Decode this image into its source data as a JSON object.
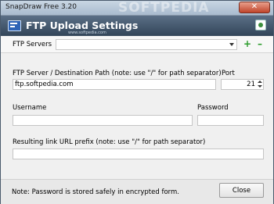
{
  "window": {
    "title": "SnapDraw Free 3.20",
    "watermark": "SOFTPEDIA",
    "close_glyph": "✕"
  },
  "banner": {
    "heading": "FTP Upload Settings",
    "sub": "www.softpedia.com"
  },
  "servers": {
    "label": "FTP Servers",
    "selected": "",
    "add_glyph": "+",
    "remove_glyph": "–"
  },
  "form": {
    "path_label": "FTP Server / Destination Path (note: use \"/\" for path separator)",
    "path_value": "ftp.softpedia.com",
    "port_label": "Port",
    "port_value": "21",
    "username_label": "Username",
    "username_value": "",
    "password_label": "Password",
    "password_value": "",
    "url_prefix_label": "Resulting link URL prefix (note: use \"/\" for path separator)",
    "url_prefix_value": ""
  },
  "footer": {
    "note": "Note: Password is stored safely in encrypted form.",
    "close_label": "Close"
  },
  "colors": {
    "banner": "#3f5268",
    "add": "#2a9b2a",
    "close_titlebar": "#c0442b"
  }
}
